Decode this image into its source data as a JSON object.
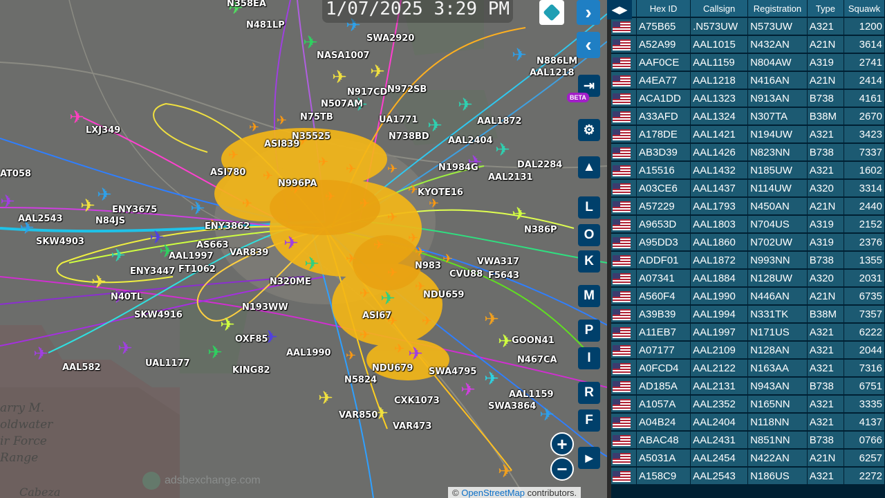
{
  "clock": "1/07/2025 3:29 PM",
  "map": {
    "places": [
      "arry M.",
      "oldwater",
      "ir Force",
      "Range",
      "Cabeza"
    ],
    "watermark": "adsbexchange.com",
    "attribution_prefix": "©",
    "attribution_link": "OpenStreetMap",
    "attribution_suffix": "contributors.",
    "aircraft_labels": [
      "N358EA",
      "N481LP",
      "SWA2920",
      "NASA1007",
      "N886LM",
      "AAL1218",
      "N917CD",
      "N972SB",
      "N507AM",
      "LXJ349",
      "N75TB",
      "UA1771",
      "AAL1872",
      "N738BD",
      "AAL2404",
      "N35525",
      "ASI839",
      "N1984G",
      "DAL2284",
      "AAL2131",
      "ASI780",
      "N996PA",
      "AT058",
      "ENY3675",
      "KYOTE16",
      "N84JS",
      "AAL2543",
      "SKW4903",
      "N386P",
      "ENY3862",
      "ENY3447",
      "AAL1997",
      "FT1062",
      "VAR839",
      "AS663",
      "N320ME",
      "CVU88",
      "F5643",
      "N40TL",
      "SKW4916",
      "N193WW",
      "NDU659",
      "ASI67",
      "OXF85",
      "AAL1990",
      "AAL582",
      "UAL1177",
      "KING82",
      "N5824",
      "NDU679",
      "SWA4795",
      "CXK1073",
      "AAL1159",
      "SWA3864",
      "VAR850",
      "VAR473",
      "GOON41",
      "N467CA",
      "N983",
      "VWA317"
    ]
  },
  "controls": {
    "letters": [
      "L",
      "O",
      "K",
      "M",
      "P",
      "I",
      "R",
      "F"
    ],
    "beta": "BETA",
    "zoom_in": "+",
    "zoom_out": "−"
  },
  "table": {
    "headers": [
      "",
      "Hex ID",
      "Callsign",
      "Registration",
      "Type",
      "Squawk"
    ],
    "rows": [
      [
        "A75B65",
        ".N573UW",
        "N573UW",
        "A321",
        "1200"
      ],
      [
        "A52A99",
        "AAL1015",
        "N432AN",
        "A21N",
        "3614"
      ],
      [
        "AAF0CE",
        "AAL1159",
        "N804AW",
        "A319",
        "2741"
      ],
      [
        "A4EA77",
        "AAL1218",
        "N416AN",
        "A21N",
        "2414"
      ],
      [
        "ACA1DD",
        "AAL1323",
        "N913AN",
        "B738",
        "4161"
      ],
      [
        "A33AFD",
        "AAL1324",
        "N307TA",
        "B38M",
        "2670"
      ],
      [
        "A178DE",
        "AAL1421",
        "N194UW",
        "A321",
        "3423"
      ],
      [
        "AB3D39",
        "AAL1426",
        "N823NN",
        "B738",
        "7337"
      ],
      [
        "A15516",
        "AAL1432",
        "N185UW",
        "A321",
        "1602"
      ],
      [
        "A03CE6",
        "AAL1437",
        "N114UW",
        "A320",
        "3314"
      ],
      [
        "A57229",
        "AAL1793",
        "N450AN",
        "A21N",
        "2440"
      ],
      [
        "A9653D",
        "AAL1803",
        "N704US",
        "A319",
        "2152"
      ],
      [
        "A95DD3",
        "AAL1860",
        "N702UW",
        "A319",
        "2376"
      ],
      [
        "ADDF01",
        "AAL1872",
        "N993NN",
        "B738",
        "1355"
      ],
      [
        "A07341",
        "AAL1884",
        "N128UW",
        "A320",
        "2031"
      ],
      [
        "A560F4",
        "AAL1990",
        "N446AN",
        "A21N",
        "6735"
      ],
      [
        "A39B39",
        "AAL1994",
        "N331TK",
        "B38M",
        "7357"
      ],
      [
        "A11EB7",
        "AAL1997",
        "N171US",
        "A321",
        "6222"
      ],
      [
        "A07177",
        "AAL2109",
        "N128AN",
        "A321",
        "2044"
      ],
      [
        "A0FCD4",
        "AAL2122",
        "N163AA",
        "A321",
        "7316"
      ],
      [
        "AD185A",
        "AAL2131",
        "N943AN",
        "B738",
        "6751"
      ],
      [
        "A1057A",
        "AAL2352",
        "N165NN",
        "A321",
        "3335"
      ],
      [
        "A04B24",
        "AAL2404",
        "N118NN",
        "A321",
        "4137"
      ],
      [
        "ABAC48",
        "AAL2431",
        "N851NN",
        "B738",
        "0766"
      ],
      [
        "A5031A",
        "AAL2454",
        "N422AN",
        "A21N",
        "6257"
      ],
      [
        "A158C9",
        "AAL2543",
        "N186US",
        "A321",
        "2272"
      ]
    ]
  }
}
